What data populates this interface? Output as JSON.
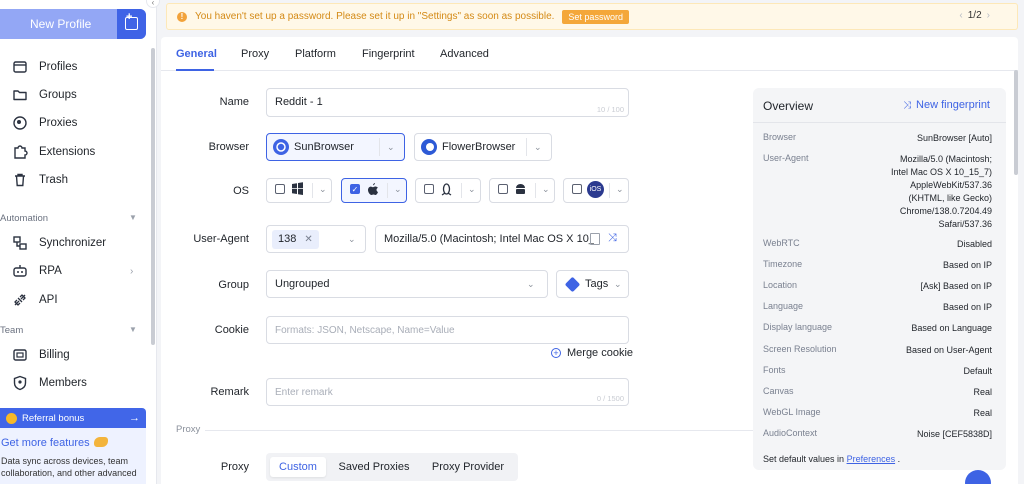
{
  "sidebar": {
    "new_profile": "New Profile",
    "items": [
      {
        "label": "Profiles",
        "icon": "profiles-icon"
      },
      {
        "label": "Groups",
        "icon": "folder-icon"
      },
      {
        "label": "Proxies",
        "icon": "globe-icon"
      },
      {
        "label": "Extensions",
        "icon": "puzzle-icon"
      },
      {
        "label": "Trash",
        "icon": "trash-icon"
      }
    ],
    "automation_title": "Automation",
    "automation_items": [
      {
        "label": "Synchronizer",
        "icon": "sync-icon"
      },
      {
        "label": "RPA",
        "icon": "robot-icon"
      },
      {
        "label": "API",
        "icon": "api-icon"
      }
    ],
    "team_title": "Team",
    "team_items": [
      {
        "label": "Billing",
        "icon": "billing-icon"
      },
      {
        "label": "Members",
        "icon": "members-icon"
      }
    ],
    "referral": {
      "header": "Referral bonus",
      "title": "Get more features",
      "text": "Data sync across devices, team collaboration, and other advanced"
    }
  },
  "banner": {
    "message": "You haven't set up a password. Please set it up in \"Settings\" as soon as possible.",
    "button": "Set password",
    "page": "1/2"
  },
  "tabs": [
    "General",
    "Proxy",
    "Platform",
    "Fingerprint",
    "Advanced"
  ],
  "form": {
    "name_label": "Name",
    "name_value": "Reddit - 1",
    "name_counter": "10 / 100",
    "browser_label": "Browser",
    "browser_options": [
      "SunBrowser",
      "FlowerBrowser"
    ],
    "os_label": "OS",
    "os_ios": "iOS",
    "ua_label": "User-Agent",
    "ua_version": "138",
    "ua_value": "Mozilla/5.0 (Macintosh; Intel Mac OS X 10_...",
    "group_label": "Group",
    "group_value": "Ungrouped",
    "tags_label": "Tags",
    "cookie_label": "Cookie",
    "cookie_placeholder": "Formats: JSON, Netscape, Name=Value",
    "merge_cookie": "Merge cookie",
    "remark_label": "Remark",
    "remark_placeholder": "Enter remark",
    "remark_counter": "0 / 1500",
    "proxy_section": "Proxy",
    "proxy_label": "Proxy",
    "proxy_options": [
      "Custom",
      "Saved Proxies",
      "Proxy Provider"
    ]
  },
  "overview": {
    "title": "Overview",
    "new_fingerprint": "New fingerprint",
    "rows": [
      {
        "k": "Browser",
        "v": "SunBrowser [Auto]"
      },
      {
        "k": "User-Agent",
        "v": "Mozilla/5.0 (Macintosh;\nIntel Mac OS X 10_15_7)\nAppleWebKit/537.36\n(KHTML, like Gecko)\nChrome/138.0.7204.49\nSafari/537.36"
      },
      {
        "k": "WebRTC",
        "v": "Disabled"
      },
      {
        "k": "Timezone",
        "v": "Based on IP"
      },
      {
        "k": "Location",
        "v": "[Ask] Based on IP"
      },
      {
        "k": "Language",
        "v": "Based on IP"
      },
      {
        "k": "Display language",
        "v": "Based on Language"
      },
      {
        "k": "Screen Resolution",
        "v": "Based on User-Agent"
      },
      {
        "k": "Fonts",
        "v": "Default"
      },
      {
        "k": "Canvas",
        "v": "Real"
      },
      {
        "k": "WebGL Image",
        "v": "Real"
      },
      {
        "k": "AudioContext",
        "v": "Noise [CEF5838D]"
      }
    ],
    "footer_prefix": "Set default values in ",
    "footer_link": "Preferences",
    "footer_suffix": " ."
  },
  "colors": {
    "accent": "#3e63e4",
    "warning": "#f4a73a",
    "sidebar_button": "#93a7f5"
  }
}
